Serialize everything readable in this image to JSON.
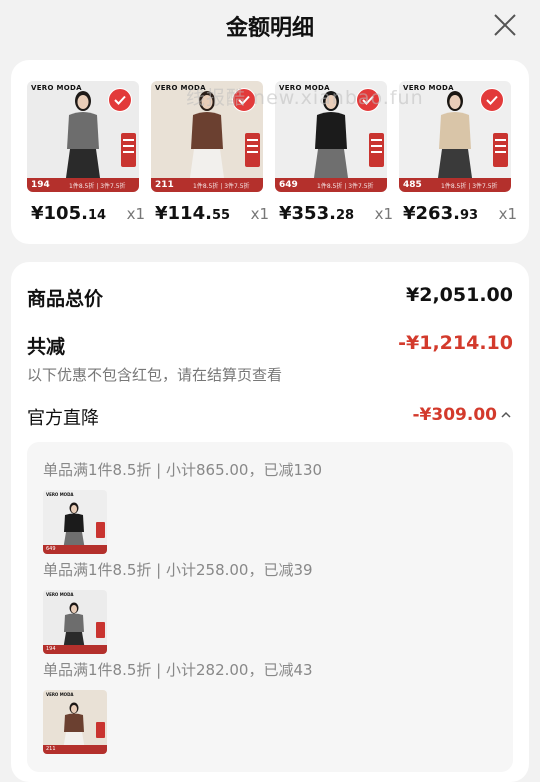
{
  "header": {
    "title": "金额明细"
  },
  "watermark": "线报酷 new.xianbao.fun",
  "products": [
    {
      "brand": "VERO MODA",
      "strip_price": "194",
      "promo": "1件8.5折 | 3件7.5折",
      "price_int": "¥105.",
      "price_dec": "14",
      "qty": "x1",
      "bg": "#ececec",
      "top": "#6d6d6d",
      "bottom": "#2a2a2a",
      "hair": "#1e1a18"
    },
    {
      "brand": "VERO MODA",
      "strip_price": "211",
      "promo": "1件8.5折 | 3件7.5折",
      "price_int": "¥114.",
      "price_dec": "55",
      "qty": "x1",
      "bg": "#e9e1d6",
      "top": "#6b4030",
      "bottom": "#f2f0ed",
      "hair": "#2a1e18"
    },
    {
      "brand": "VERO MODA",
      "strip_price": "649",
      "promo": "1件8.5折 | 3件7.5折",
      "price_int": "¥353.",
      "price_dec": "28",
      "qty": "x1",
      "bg": "#eeeeee",
      "top": "#1b1b1b",
      "bottom": "#6f6f6f",
      "hair": "#151515"
    },
    {
      "brand": "VERO MODA",
      "strip_price": "485",
      "promo": "1件8.5折 | 3件7.5折",
      "price_int": "¥263.",
      "price_dec": "93",
      "qty": "x1",
      "bg": "#efefef",
      "top": "#d9c5a8",
      "bottom": "#3a3a3a",
      "hair": "#1a1612"
    }
  ],
  "summary": {
    "total_label": "商品总价",
    "total_value": "¥2,051.00",
    "reduce_label": "共减",
    "reduce_value": "-¥1,214.10",
    "note": "以下优惠不包含红包，请在结算页查看",
    "official_label": "官方直降",
    "official_value": "-¥309.00"
  },
  "discount_groups": [
    {
      "text": "单品满1件8.5折 | 小计865.00，已减130",
      "brand": "VERO MODA",
      "strip": "649",
      "bg": "#eeeeee",
      "top": "#1b1b1b",
      "bottom": "#6f6f6f"
    },
    {
      "text": "单品满1件8.5折 | 小计258.00，已减39",
      "brand": "VERO MODA",
      "strip": "194",
      "bg": "#ececec",
      "top": "#6d6d6d",
      "bottom": "#2a2a2a"
    },
    {
      "text": "单品满1件8.5折 | 小计282.00，已减43",
      "brand": "VERO MODA",
      "strip": "211",
      "bg": "#e9e1d6",
      "top": "#6b4030",
      "bottom": "#f2f0ed"
    }
  ],
  "colors": {
    "accent": "#d33a2c",
    "check": "#e23a3a",
    "strip": "#b4302c"
  }
}
